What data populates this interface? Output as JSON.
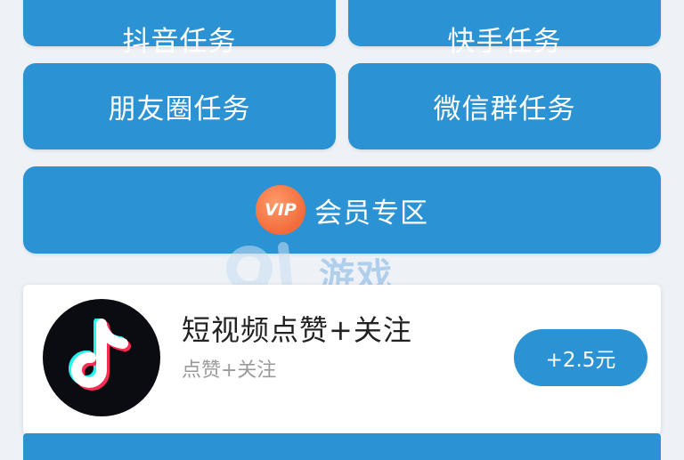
{
  "tasks": {
    "douyin": "抖音任务",
    "kuaishou": "快手任务",
    "moments": "朋友圈任务",
    "wechat_group": "微信群任务"
  },
  "vip": {
    "badge": "VIP",
    "label": "会员专区"
  },
  "task_card": {
    "icon": "tiktok-logo-icon",
    "title": "短视频点赞+关注",
    "subtitle": "点赞+关注",
    "reward": "+2.5元"
  },
  "watermark": {
    "logo_text": "游戏"
  },
  "colors": {
    "primary": "#2b93d3",
    "vip_badge": "#f26b3a",
    "background": "#eef2f6"
  }
}
